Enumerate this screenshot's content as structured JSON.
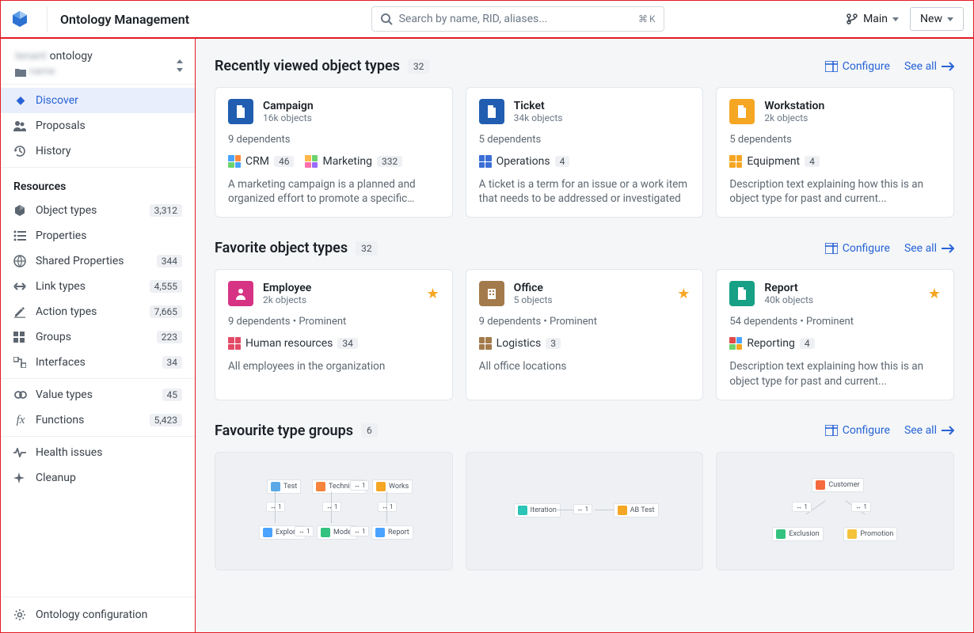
{
  "app_title": "Ontology Management",
  "search_placeholder": "Search by name, RID, aliases...",
  "search_kbd_cmd": "⌘",
  "search_kbd_key": "K",
  "branch_label": "Main",
  "new_label": "New",
  "sidebar": {
    "ontology_name_blur": "tenant",
    "ontology_name": "ontology",
    "folder_blur": "name",
    "nav": [
      {
        "label": "Discover",
        "active": true
      },
      {
        "label": "Proposals"
      },
      {
        "label": "History"
      }
    ],
    "resources_header": "Resources",
    "resources": [
      {
        "label": "Object types",
        "count": "3,312"
      },
      {
        "label": "Properties"
      },
      {
        "label": "Shared Properties",
        "count": "344"
      },
      {
        "label": "Link types",
        "count": "4,555"
      },
      {
        "label": "Action types",
        "count": "7,665"
      },
      {
        "label": "Groups",
        "count": "223"
      },
      {
        "label": "Interfaces",
        "count": "34"
      }
    ],
    "secondary": [
      {
        "label": "Value types",
        "count": "45"
      },
      {
        "label": "Functions",
        "count": "5,423"
      }
    ],
    "tertiary": [
      {
        "label": "Health issues"
      },
      {
        "label": "Cleanup"
      }
    ],
    "footer": {
      "label": "Ontology configuration"
    }
  },
  "configure_label": "Configure",
  "seeall_label": "See all",
  "sections": {
    "recent": {
      "title": "Recently viewed object types",
      "badge": "32",
      "cards": [
        {
          "name": "Campaign",
          "sub": "16k objects",
          "dep": "9 dependents",
          "groups": [
            {
              "name": "CRM",
              "count": "46"
            },
            {
              "name": "Marketing",
              "count": "332"
            }
          ],
          "desc": "A marketing campaign is a planned and organized effort to promote a specific comp…"
        },
        {
          "name": "Ticket",
          "sub": "34k objects",
          "dep": "5 dependents",
          "groups": [
            {
              "name": "Operations",
              "count": "4"
            }
          ],
          "desc": "A ticket is a term for an issue or a work item that needs to be addressed or investigated"
        },
        {
          "name": "Workstation",
          "sub": "2k objects",
          "dep": "5 dependents",
          "groups": [
            {
              "name": "Equipment",
              "count": "4"
            }
          ],
          "desc": "Description text explaining how this is an object type for past and current..."
        }
      ]
    },
    "fav": {
      "title": "Favorite object types",
      "badge": "32",
      "cards": [
        {
          "name": "Employee",
          "sub": "2k objects",
          "dep": "9 dependents  •  Prominent",
          "groups": [
            {
              "name": "Human resources",
              "count": "34"
            }
          ],
          "desc": "All employees in the organization"
        },
        {
          "name": "Office",
          "sub": "5 objects",
          "dep": "9 dependents  •  Prominent",
          "groups": [
            {
              "name": "Logistics",
              "count": "3"
            }
          ],
          "desc": "All office locations"
        },
        {
          "name": "Report",
          "sub": "40k objects",
          "dep": "54 dependents  •  Prominent",
          "groups": [
            {
              "name": "Reporting",
              "count": "4"
            }
          ],
          "desc": "Description text explaining how this is an object type for past and current..."
        }
      ]
    },
    "groups": {
      "title": "Favourite type groups",
      "badge": "6",
      "diagrams": [
        {
          "nodes": [
            "Test",
            "Technician",
            "Works",
            "Explorer",
            "Model",
            "Report"
          ]
        },
        {
          "nodes": [
            "Iteration",
            "AB Test"
          ]
        },
        {
          "nodes": [
            "Customer",
            "Exclusion",
            "Promotion"
          ]
        }
      ]
    }
  }
}
